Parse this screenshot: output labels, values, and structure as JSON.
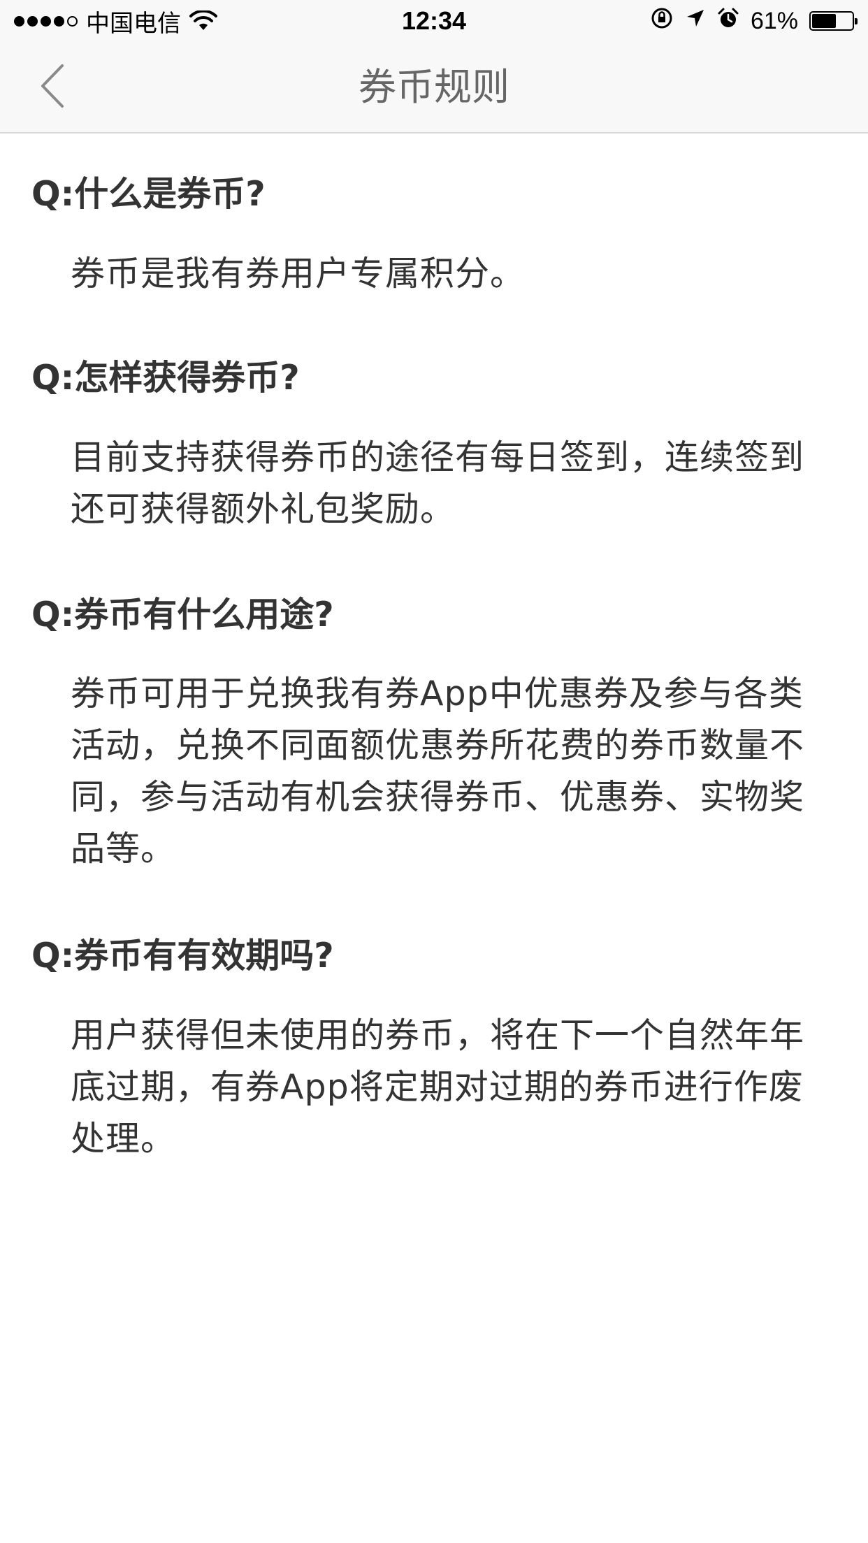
{
  "status_bar": {
    "carrier": "中国电信",
    "time": "12:34",
    "battery_text": "61%",
    "battery_level": 0.61,
    "signal_bars": 4,
    "signal_total": 5,
    "icons": [
      "wifi-icon",
      "rotation-lock-icon",
      "location-icon",
      "alarm-icon",
      "battery-icon"
    ]
  },
  "nav": {
    "title": "券币规则",
    "back_icon": "chevron-left-icon"
  },
  "faq": [
    {
      "question": "Q:什么是券币?",
      "answer": "券币是我有券用户专属积分。"
    },
    {
      "question": "Q:怎样获得券币?",
      "answer": "目前支持获得券币的途径有每日签到，连续签到还可获得额外礼包奖励。"
    },
    {
      "question": "Q:券币有什么用途?",
      "answer": "券币可用于兑换我有券App中优惠券及参与各类活动，兑换不同面额优惠券所花费的券币数量不同，参与活动有机会获得券币、优惠券、实物奖品等。"
    },
    {
      "question": "Q:券币有有效期吗?",
      "answer": "用户获得但未使用的券币，将在下一个自然年年底过期，有券App将定期对过期的券币进行作废处理。"
    }
  ],
  "colors": {
    "text": "#333333",
    "title": "#666666",
    "bar_background": "#f8f8f8",
    "divider": "#d6d6d6"
  }
}
